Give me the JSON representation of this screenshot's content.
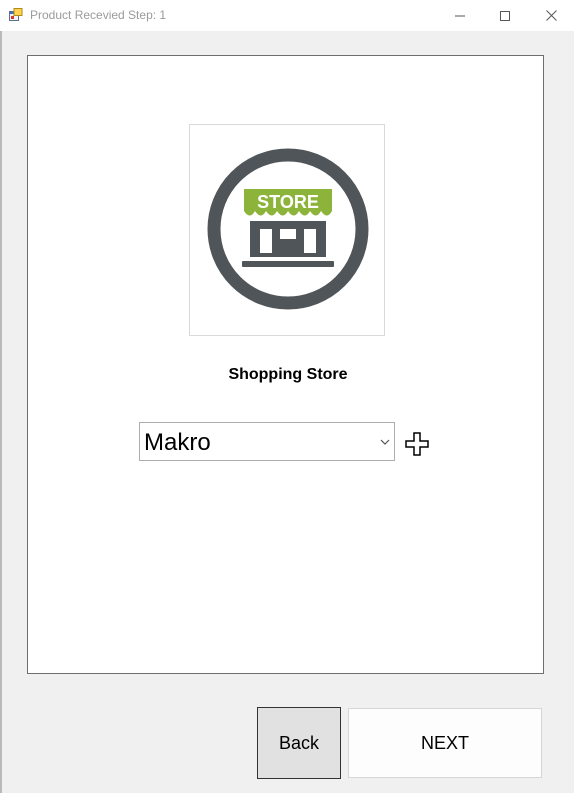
{
  "window": {
    "title": "Product Recevied Step: 1",
    "app_icon": "form-icon",
    "controls": [
      "minimize-icon",
      "maximize-icon",
      "close-icon"
    ]
  },
  "store_image": {
    "icon": "store-icon",
    "sign_text": "STORE",
    "colors": {
      "ring": "#4f5559",
      "awning": "#8db43a"
    }
  },
  "store_label": "Shopping Store",
  "store_select": {
    "selected": "Makro"
  },
  "buttons": {
    "back": "Back",
    "next": "NEXT"
  }
}
